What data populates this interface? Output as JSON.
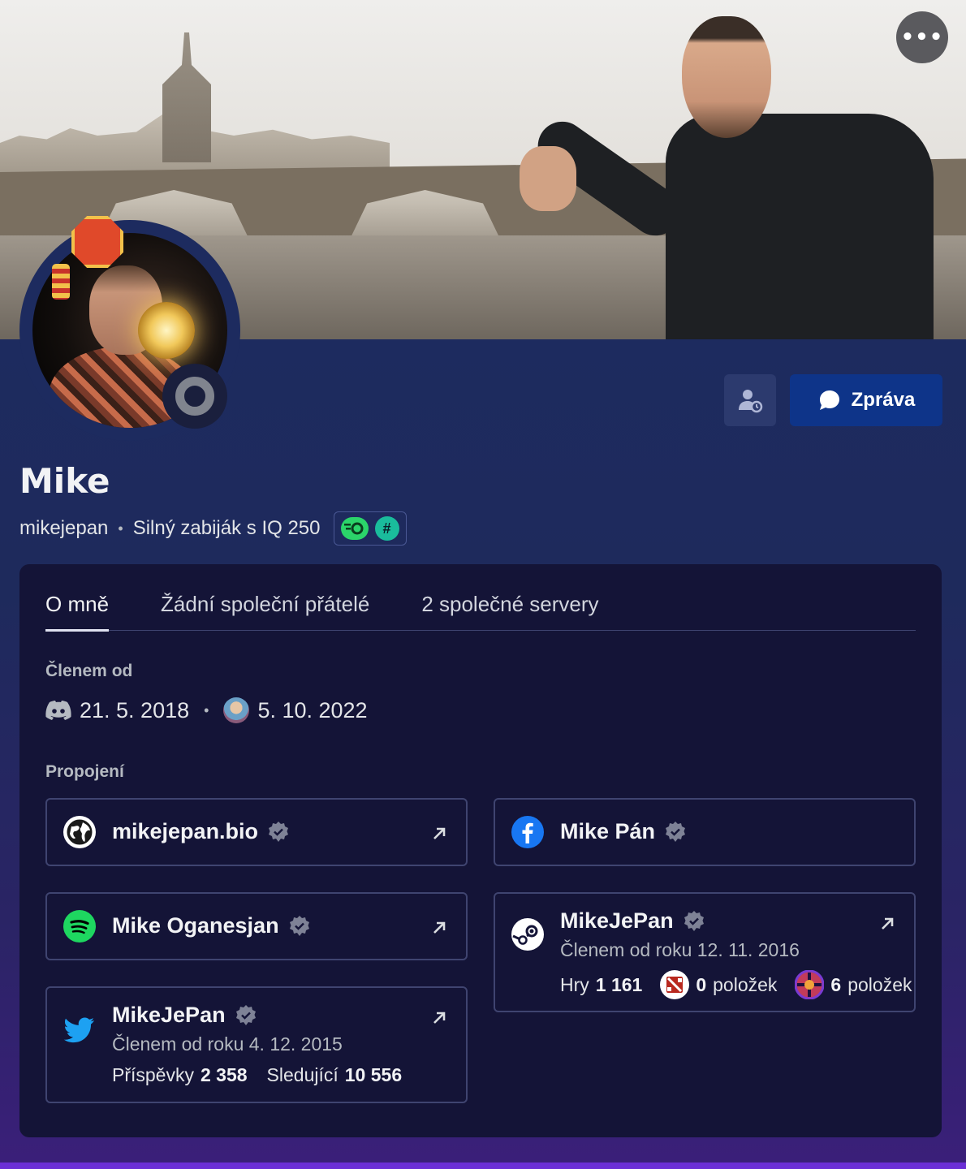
{
  "header": {
    "more_label": "•••"
  },
  "profile": {
    "display_name": "Mike",
    "username": "mikejepan",
    "separator": "•",
    "custom_status": "Silný zabiják s IQ 250",
    "status": "offline",
    "badges": [
      "nitro-badge",
      "hypesquad-hash-badge"
    ]
  },
  "actions": {
    "message_label": "Zpráva"
  },
  "tabs": [
    {
      "label": "O mně",
      "active": true
    },
    {
      "label": "Žádní společní přátelé",
      "active": false
    },
    {
      "label": "2 společné servery",
      "active": false
    }
  ],
  "member_since": {
    "heading": "Členem od",
    "discord_date": "21. 5. 2018",
    "separator": "•",
    "server_date": "5. 10. 2022"
  },
  "connections": {
    "heading": "Propojení",
    "website": {
      "name": "mikejepan.bio"
    },
    "facebook": {
      "name": "Mike Pán"
    },
    "spotify": {
      "name": "Mike Oganesjan"
    },
    "steam": {
      "name": "MikeJePan",
      "member_since": "Členem od roku 12. 11. 2016",
      "games_label": "Hry",
      "games_count": "1 161",
      "dota_count": "0",
      "dota_label": "položek",
      "tf2_count": "6",
      "tf2_label": "položek"
    },
    "twitter": {
      "name": "MikeJePan",
      "member_since": "Členem od roku 4. 12. 2015",
      "posts_label": "Příspěvky",
      "posts_count": "2 358",
      "followers_label": "Sledující",
      "followers_count": "10 556"
    }
  },
  "colors": {
    "accent": "#0e3489",
    "panel": "#141437",
    "spotify": "#1ed760",
    "facebook": "#1877f2",
    "twitter": "#1da1f2"
  }
}
